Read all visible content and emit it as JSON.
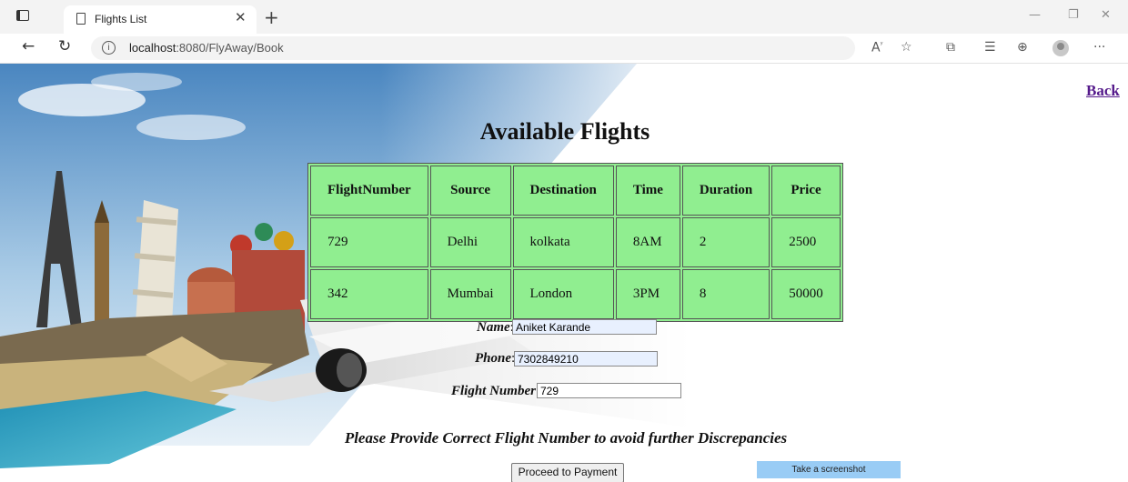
{
  "browser": {
    "tab_title": "Flights List",
    "url_host": "localhost",
    "url_rest": ":8080/FlyAway/Book"
  },
  "page": {
    "back_label": "Back",
    "heading": "Available Flights",
    "table": {
      "headers": [
        "FlightNumber",
        "Source",
        "Destination",
        "Time",
        "Duration",
        "Price"
      ],
      "rows": [
        [
          "729",
          "Delhi",
          "kolkata",
          "8AM",
          "2",
          "2500"
        ],
        [
          "342",
          "Mumbai",
          "London",
          "3PM",
          "8",
          "50000"
        ]
      ]
    },
    "form": {
      "name_label": "Name",
      "name_value": "Aniket Karande",
      "phone_label": "Phone",
      "phone_value": "7302849210",
      "flight_label": "Flight Number",
      "flight_value": "729",
      "colon": ":"
    },
    "notice": "Please Provide Correct Flight Number to avoid further Discrepancies",
    "submit_label": "Proceed to Payment",
    "screenshot_label": "Take a screenshot"
  },
  "colors": {
    "table_bg": "#90ee90",
    "link": "#551a8b",
    "autofill": "#e8f0fe",
    "screenshot_button": "#99ccf5"
  },
  "icons": [
    "tab-actions-icon",
    "document-icon",
    "close-icon",
    "plus-icon",
    "minimize-icon",
    "restore-icon",
    "window-close-icon",
    "back-arrow-icon",
    "refresh-icon",
    "info-icon",
    "read-aloud-icon",
    "favorite-icon",
    "extensions-icon",
    "favorites-bar-icon",
    "collections-icon",
    "profile-icon",
    "more-icon"
  ]
}
